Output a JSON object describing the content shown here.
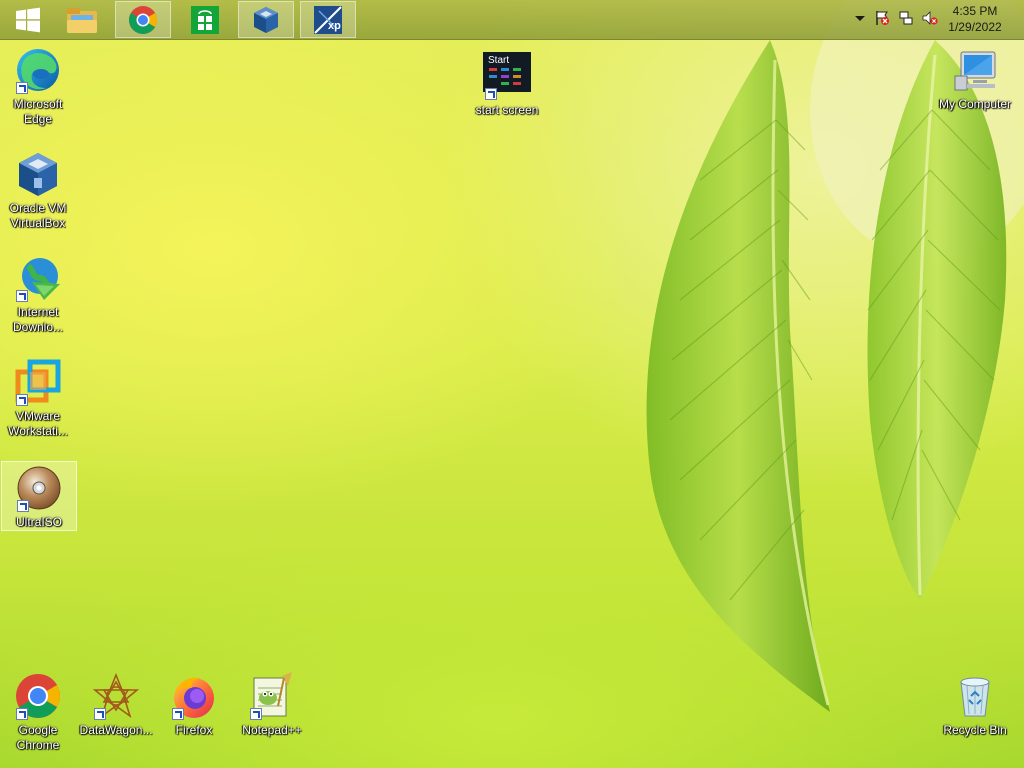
{
  "taskbar": {
    "pinned": [
      {
        "name": "start-button",
        "icon": "windows-logo-icon"
      },
      {
        "name": "file-explorer-taskbar-button",
        "icon": "folder-icon"
      },
      {
        "name": "chrome-taskbar-button",
        "icon": "chrome-icon",
        "active": true
      },
      {
        "name": "store-taskbar-button",
        "icon": "store-icon"
      },
      {
        "name": "virtualbox-taskbar-button",
        "icon": "virtualbox-icon",
        "active": true
      },
      {
        "name": "xp-mode-taskbar-button",
        "icon": "xp-icon",
        "active": true
      }
    ],
    "clock": {
      "time": "4:35 PM",
      "date": "1/29/2022"
    },
    "tray": [
      "show-hidden-icons-chevron-icon",
      "action-center-flag-icon",
      "network-icon",
      "volume-muted-icon"
    ]
  },
  "desktop": {
    "icons": [
      {
        "id": "edge",
        "label": "Microsoft Edge",
        "icon": "edge-icon",
        "shortcut": true
      },
      {
        "id": "virtualbox",
        "label": "Oracle VM VirtualBox",
        "icon": "virtualbox-icon",
        "shortcut": false
      },
      {
        "id": "idm",
        "label": "Internet Downlo...",
        "icon": "internet-download-manager-icon",
        "shortcut": true
      },
      {
        "id": "vmware",
        "label": "VMware Workstati...",
        "icon": "vmware-icon",
        "shortcut": true
      },
      {
        "id": "ultraiso",
        "label": "UltraISO",
        "icon": "disc-icon",
        "shortcut": true,
        "selected": true
      },
      {
        "id": "startscreen",
        "label": "start screen",
        "icon": "start-screen-icon",
        "icon_text": "Start",
        "shortcut": true
      },
      {
        "id": "mycomputer",
        "label": "My Computer",
        "icon": "computer-icon",
        "shortcut": false
      },
      {
        "id": "chrome",
        "label": "Google Chrome",
        "icon": "chrome-icon",
        "shortcut": true
      },
      {
        "id": "datawagon",
        "label": "DataWagon...",
        "icon": "datawagon-icon",
        "shortcut": true
      },
      {
        "id": "firefox",
        "label": "Firefox",
        "icon": "firefox-icon",
        "shortcut": true
      },
      {
        "id": "notepadpp",
        "label": "Notepad++",
        "icon": "notepadpp-icon",
        "shortcut": true
      },
      {
        "id": "recyclebin",
        "label": "Recycle Bin",
        "icon": "recycle-bin-icon",
        "shortcut": false
      }
    ]
  }
}
